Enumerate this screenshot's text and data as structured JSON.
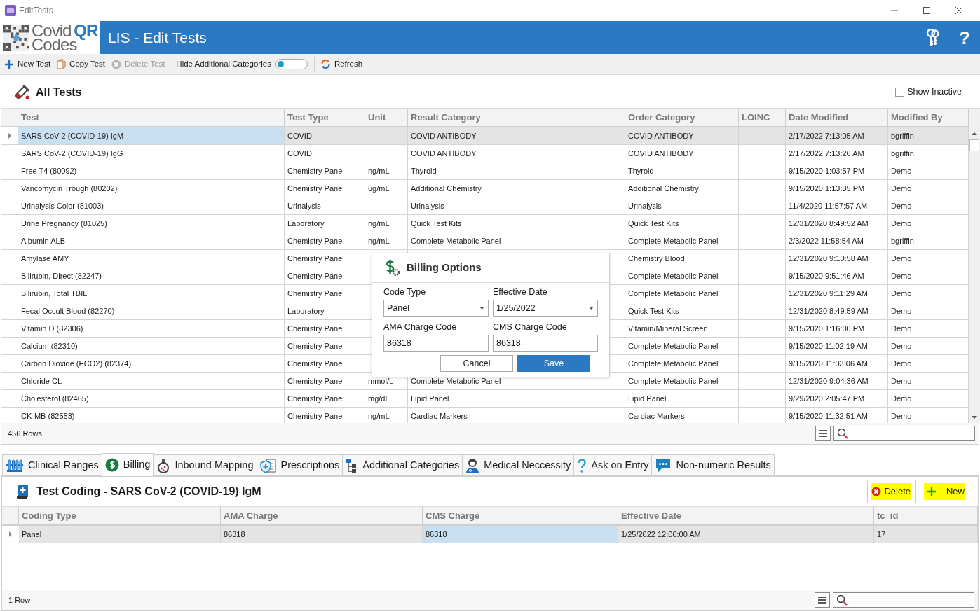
{
  "window": {
    "title": "EditTests",
    "app_title": "LIS - Edit Tests",
    "logo": {
      "word1": "Covid",
      "word2": "QR",
      "word3": "Codes"
    },
    "help": "?"
  },
  "toolbar": [
    {
      "kind": "button",
      "label": "New Test",
      "disabled": false
    },
    {
      "kind": "button",
      "label": "Copy Test",
      "disabled": false
    },
    {
      "kind": "button",
      "label": "Delete Test",
      "disabled": true
    },
    {
      "kind": "toggle",
      "label": "Hide Additional Categories",
      "on": false
    },
    {
      "kind": "button",
      "label": "Refresh",
      "disabled": false
    }
  ],
  "tests_panel": {
    "title": "All Tests",
    "show_inactive": {
      "label": "Show Inactive",
      "checked": false
    },
    "columns": [
      "Test",
      "Test Type",
      "Unit",
      "Result Category",
      "Order Category",
      "LOINC",
      "Date Modified",
      "Modified By"
    ],
    "rows": [
      {
        "selected": true,
        "cells": [
          {
            "text": "SARS CoV-2 (COVID-19) IgM",
            "selected": true
          },
          {
            "text": "COVID",
            "selected": false
          },
          {
            "text": null,
            "selected": false
          },
          {
            "text": "COVID ANTIBODY",
            "selected": false
          },
          {
            "text": "COVID ANTIBODY",
            "selected": false
          },
          {
            "text": null,
            "selected": false
          },
          {
            "text": "2/17/2022 7:13:05 AM",
            "selected": false
          },
          {
            "text": "bgriffin",
            "selected": false
          }
        ]
      },
      {
        "selected": false,
        "cells": [
          "SARS CoV-2 (COVID-19) IgG",
          "COVID",
          null,
          "COVID ANTIBODY",
          "COVID ANTIBODY",
          null,
          "2/17/2022 7:13:26 AM",
          "bgriffin"
        ]
      },
      {
        "selected": false,
        "cells": [
          "Free T4 (80092)",
          "Chemistry Panel",
          "ng/mL",
          "Thyroid",
          "Thyroid",
          null,
          "9/15/2020 1:03:57 PM",
          "Demo"
        ]
      },
      {
        "selected": false,
        "cells": [
          "Vancomycin Trough (80202)",
          "Chemistry Panel",
          "ug/mL",
          "Additional Chemistry",
          "Additional Chemistry",
          null,
          "9/15/2020 1:13:35 PM",
          "Demo"
        ]
      },
      {
        "selected": false,
        "cells": [
          "Urinalysis Color (81003)",
          "Urinalysis",
          null,
          "Urinalysis",
          "Urinalysis",
          null,
          "11/4/2020 11:57:57 AM",
          "Demo"
        ]
      },
      {
        "selected": false,
        "cells": [
          "Urine Pregnancy (81025)",
          "Laboratory",
          "ng/mL",
          "Quick Test Kits",
          "Quick Test Kits",
          null,
          "12/31/2020 8:49:52 AM",
          "Demo"
        ]
      },
      {
        "selected": false,
        "cells": [
          "Albumin ALB",
          "Chemistry Panel",
          "ng/mL",
          "Complete Metabolic Panel",
          "Complete Metabolic Panel",
          null,
          "2/3/2022 11:58:54 AM",
          "bgriffin"
        ]
      },
      {
        "selected": false,
        "cells": [
          "Amylase AMY",
          "Chemistry Panel",
          null,
          null,
          "Chemistry Blood",
          null,
          "12/31/2020 9:10:58 AM",
          "Demo"
        ]
      },
      {
        "selected": false,
        "cells": [
          "Bilirubin, Direct (82247)",
          "Chemistry Panel",
          null,
          null,
          "Complete Metabolic Panel",
          null,
          "9/15/2020 9:51:46 AM",
          "Demo"
        ]
      },
      {
        "selected": false,
        "cells": [
          "Bilirubin, Total TBIL",
          "Chemistry Panel",
          null,
          null,
          "Complete Metabolic Panel",
          null,
          "12/31/2020 9:11:29 AM",
          "Demo"
        ]
      },
      {
        "selected": false,
        "cells": [
          "Fecal Occult Blood (82270)",
          "Laboratory",
          null,
          null,
          "Quick Test Kits",
          null,
          "12/31/2020 8:49:59 AM",
          "Demo"
        ]
      },
      {
        "selected": false,
        "cells": [
          "Vitamin D (82306)",
          "Chemistry Panel",
          null,
          null,
          "Vitamin/Mineral Screen",
          null,
          "9/15/2020 1:16:00 PM",
          "Demo"
        ]
      },
      {
        "selected": false,
        "cells": [
          "Calcium (82310)",
          "Chemistry Panel",
          null,
          null,
          "Complete Metabolic Panel",
          null,
          "9/15/2020 11:02:19 AM",
          "Demo"
        ]
      },
      {
        "selected": false,
        "cells": [
          "Carbon Dioxide (ECO2) (82374)",
          "Chemistry Panel",
          null,
          null,
          "Complete Metabolic Panel",
          null,
          "9/15/2020 11:03:06 AM",
          "Demo"
        ]
      },
      {
        "selected": false,
        "cells": [
          "Chloride CL-",
          "Chemistry Panel",
          "mmol/L",
          "Complete Metabolic Panel",
          "Complete Metabolic Panel",
          null,
          "12/31/2020 9:04:36 AM",
          "Demo"
        ]
      },
      {
        "selected": false,
        "cells": [
          "Cholesterol (82465)",
          "Chemistry Panel",
          "mg/dL",
          "Lipid Panel",
          "Lipid Panel",
          null,
          "9/29/2020 2:05:47 PM",
          "Demo"
        ]
      },
      {
        "selected": false,
        "cells": [
          "CK-MB (82553)",
          "Chemistry Panel",
          "ng/mL",
          "Cardiac Markers",
          "Cardiac Markers",
          null,
          "9/15/2020 11:32:51 AM",
          "Demo"
        ]
      }
    ],
    "row_count": "456 Rows"
  },
  "dialog": {
    "title": "Billing Options",
    "fields": [
      {
        "kind": "select",
        "label": "Code Type",
        "value": "Panel"
      },
      {
        "kind": "select",
        "label": "Effective Date",
        "value": "1/25/2022"
      },
      {
        "kind": "text",
        "label": "AMA Charge Code",
        "value": "86318"
      },
      {
        "kind": "text",
        "label": "CMS Charge Code",
        "value": "86318"
      }
    ],
    "buttons": [
      {
        "label": "Cancel",
        "primary": false
      },
      {
        "label": "Save",
        "primary": true
      }
    ]
  },
  "tabs": [
    {
      "label": "Clinical Ranges",
      "selected": false
    },
    {
      "label": "Billing",
      "selected": true
    },
    {
      "label": "Inbound Mapping",
      "selected": false
    },
    {
      "label": "Prescriptions",
      "selected": false
    },
    {
      "label": "Additional Categories",
      "selected": false
    },
    {
      "label": "Medical Neccessity",
      "selected": false
    },
    {
      "label": "Ask on Entry",
      "selected": false
    },
    {
      "label": "Non-numeric Results",
      "selected": false
    }
  ],
  "coding_panel": {
    "title": "Test Coding - SARS CoV-2 (COVID-19) IgM",
    "buttons": [
      {
        "kind": "delete",
        "label": "Delete",
        "highlighted": true
      },
      {
        "kind": "add",
        "label": "New",
        "highlighted": true
      }
    ],
    "columns": [
      "Coding Type",
      "AMA Charge",
      "CMS Charge",
      "Effective Date",
      "tc_id"
    ],
    "rows": [
      {
        "selected": true,
        "cells": [
          {
            "text": "Panel",
            "selected": false
          },
          {
            "text": "86318",
            "selected": false
          },
          {
            "text": "86318",
            "selected": true
          },
          {
            "text": "1/25/2022 12:00:00 AM",
            "selected": false
          },
          {
            "text": "17",
            "selected": false
          }
        ]
      }
    ],
    "row_count": "1 Row"
  }
}
